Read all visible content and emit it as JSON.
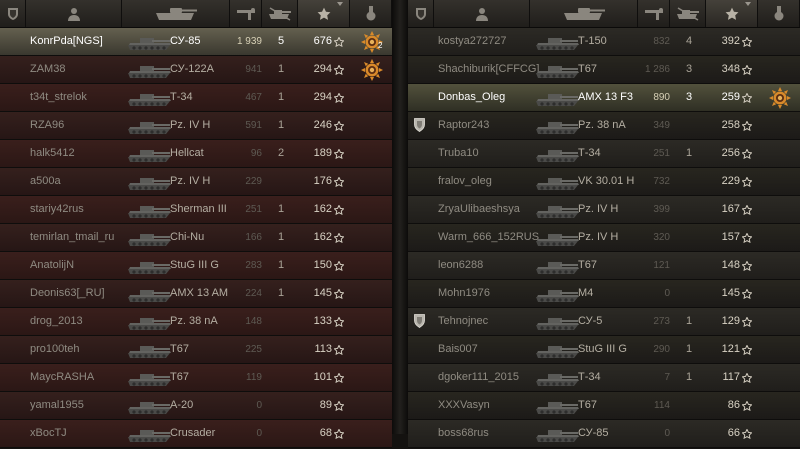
{
  "teams": [
    {
      "players": [
        {
          "name": "KonrPda[NGS]",
          "vehicle": "СУ-85",
          "xp": "1 939",
          "frags": "5",
          "score": "676",
          "style": "me",
          "medal": "ace-tanker-medal",
          "medal_count": "2"
        },
        {
          "name": "ZAM38",
          "vehicle": "СУ-122А",
          "xp": "941",
          "frags": "1",
          "score": "294",
          "style": "red",
          "medal": "ace-tanker-medal"
        },
        {
          "name": "t34t_strelok",
          "vehicle": "Т-34",
          "xp": "467",
          "frags": "1",
          "score": "294",
          "style": "red"
        },
        {
          "name": "RZA96",
          "vehicle": "Pz. IV H",
          "xp": "591",
          "frags": "1",
          "score": "246",
          "style": "red"
        },
        {
          "name": "halk5412",
          "vehicle": "Hellcat",
          "xp": "96",
          "frags": "2",
          "score": "189",
          "style": "red"
        },
        {
          "name": "a500a",
          "vehicle": "Pz. IV H",
          "xp": "229",
          "frags": "",
          "score": "176",
          "style": "red"
        },
        {
          "name": "stariy42rus",
          "vehicle": "Sherman III",
          "xp": "251",
          "frags": "1",
          "score": "162",
          "style": "red"
        },
        {
          "name": "temirlan_tmail_ru",
          "vehicle": "Chi-Nu",
          "xp": "166",
          "frags": "1",
          "score": "162",
          "style": "red"
        },
        {
          "name": "AnatolijN",
          "vehicle": "StuG III G",
          "xp": "283",
          "frags": "1",
          "score": "150",
          "style": "red"
        },
        {
          "name": "Deonis63[_RU]",
          "vehicle": "AMX 13 AM",
          "xp": "224",
          "frags": "1",
          "score": "145",
          "style": "red"
        },
        {
          "name": "drog_2013",
          "vehicle": "Pz. 38 nA",
          "xp": "148",
          "frags": "",
          "score": "133",
          "style": "red"
        },
        {
          "name": "pro100teh",
          "vehicle": "T67",
          "xp": "225",
          "frags": "",
          "score": "113",
          "style": "red"
        },
        {
          "name": "MaycRASHA",
          "vehicle": "T67",
          "xp": "119",
          "frags": "",
          "score": "101",
          "style": "red"
        },
        {
          "name": "yamal1955",
          "vehicle": "A-20",
          "xp": "0",
          "frags": "",
          "score": "89",
          "style": "red"
        },
        {
          "name": "xBocTJ",
          "vehicle": "Crusader",
          "xp": "0",
          "frags": "",
          "score": "68",
          "style": "red"
        }
      ]
    },
    {
      "players": [
        {
          "name": "kostya272727",
          "vehicle": "Т-150",
          "xp": "832",
          "frags": "4",
          "score": "392",
          "style": "green"
        },
        {
          "name": "Shachiburik[CFFCG]",
          "vehicle": "T67",
          "xp": "1 286",
          "frags": "3",
          "score": "348",
          "style": "green"
        },
        {
          "name": "Donbas_Oleg",
          "vehicle": "AMX 13 F3",
          "xp": "890",
          "frags": "3",
          "score": "259",
          "style": "self",
          "medal": "ace-tanker-medal"
        },
        {
          "name": "Raptor243",
          "vehicle": "Pz. 38 nA",
          "xp": "349",
          "frags": "",
          "score": "258",
          "style": "green",
          "squad": true
        },
        {
          "name": "Truba10",
          "vehicle": "Т-34",
          "xp": "251",
          "frags": "1",
          "score": "256",
          "style": "green"
        },
        {
          "name": "fralov_oleg",
          "vehicle": "VK 30.01 H",
          "xp": "732",
          "frags": "",
          "score": "229",
          "style": "green"
        },
        {
          "name": "ZryaUlibaeshsya",
          "vehicle": "Pz. IV H",
          "xp": "399",
          "frags": "",
          "score": "167",
          "style": "green"
        },
        {
          "name": "Warm_666_152RUS",
          "vehicle": "Pz. IV H",
          "xp": "320",
          "frags": "",
          "score": "157",
          "style": "green"
        },
        {
          "name": "leon6288",
          "vehicle": "T67",
          "xp": "121",
          "frags": "",
          "score": "148",
          "style": "green"
        },
        {
          "name": "Mohn1976",
          "vehicle": "M4",
          "xp": "0",
          "frags": "",
          "score": "145",
          "style": "green"
        },
        {
          "name": "Tehnojnec",
          "vehicle": "СУ-5",
          "xp": "273",
          "frags": "1",
          "score": "129",
          "style": "green",
          "squad": true
        },
        {
          "name": "Bais007",
          "vehicle": "StuG III G",
          "xp": "290",
          "frags": "1",
          "score": "121",
          "style": "green"
        },
        {
          "name": "dgoker111_2015",
          "vehicle": "Т-34",
          "xp": "7",
          "frags": "1",
          "score": "117",
          "style": "green"
        },
        {
          "name": "XXXVasyn",
          "vehicle": "T67",
          "xp": "114",
          "frags": "",
          "score": "86",
          "style": "green"
        },
        {
          "name": "boss68rus",
          "vehicle": "СУ-85",
          "xp": "0",
          "frags": "",
          "score": "66",
          "style": "green"
        }
      ]
    }
  ],
  "icons": {
    "header": [
      "platoon-icon",
      "player-icon",
      "vehicle-icon",
      "experience-icon",
      "frags-icon",
      "score-star-icon",
      "medal-icon"
    ],
    "row_star": "star-icon",
    "row_tank": "tank-icon",
    "squad": "squad-shield-icon"
  },
  "colors": {
    "accent": "#d8d2c4",
    "red_row": "#3a1f1c",
    "green_row": "#2c2a25",
    "highlight": "#64604f",
    "medal": "#d98a2a"
  }
}
